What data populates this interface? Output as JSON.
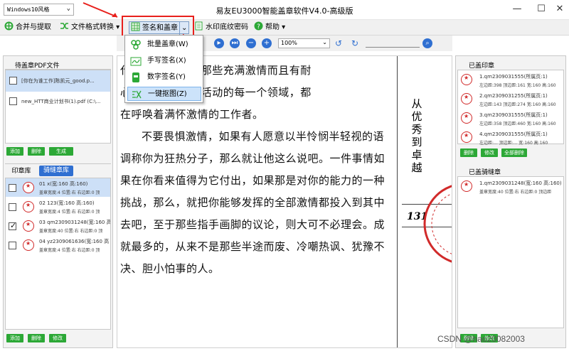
{
  "titlebar": {
    "style_select": "Windows10风格",
    "title": "易友EU3000智能盖章软件V4.0-高级版",
    "min": "—",
    "max": "☐",
    "close": "✕"
  },
  "toolbar": {
    "merge": "合并与提取",
    "convert": "文件格式转换",
    "sign": "签名和盖章",
    "watermark": "水印底纹密码",
    "help": "帮助"
  },
  "menu": {
    "items": [
      {
        "label": "批量盖章",
        "key": "(W)"
      },
      {
        "label": "手写签名",
        "key": "(X)"
      },
      {
        "label": "数字签名",
        "key": "(Y)"
      },
      {
        "label": "一键抠图",
        "key": "(Z)"
      }
    ]
  },
  "left": {
    "pdf_header": "待盖章PDF文件",
    "files": [
      "[你在为谁工作]陈凯元_good.p...",
      "new_HTT商业计划书(1).pdf (C:\\..."
    ],
    "file_buttons": [
      "添加",
      "删除",
      "生成"
    ],
    "tabs": [
      "印章库",
      "骑缝章库"
    ],
    "seals": [
      {
        "name": "01 x(宽:160 高:160)",
        "detail": "盖章宽度:4 位置:右 右边距:0 顶",
        "checked": false
      },
      {
        "name": "02 123(宽:160 高:160)",
        "detail": "盖章宽度:4 位置:右 右边距:0 顶",
        "checked": false
      },
      {
        "name": "03 qm2309031248(宽:160 高",
        "detail": "盖章宽度:40 位置:右 右边距:0 顶",
        "checked": true
      },
      {
        "name": "04 yz2309061636(宽:160 高",
        "detail": "盖章宽度:4 位置:右 右边距:0 顶",
        "checked": false
      }
    ],
    "seal_buttons": [
      "添加",
      "删除",
      "修改"
    ]
  },
  "doctoolbar": {
    "zoom": "100%"
  },
  "document": {
    "lines": [
      "代                物，都等待着那些充满激情而且有耐",
      "心                行各业，人类活动的每一个领域，都",
      "在呼唤着满怀激情的工作者。",
      "不要畏惧激情，如果有人愿意以半怜悯半轻视的语",
      "调称你为狂热分子，那么就让他这么说吧。一件事情如",
      "果在你看来值得为它付出，如果那是对你的能力的一种",
      "挑战，那么，就把你能够发挥的全部激情都投入到其中",
      "去吧，至于那些指手画脚的议论，则大可不必理会。成",
      "就最多的，从来不是那些半途而废、冷嘲热讽、犹豫不",
      "决、胆小怕事的人。"
    ],
    "sidebar_title": "从优秀到卓越",
    "page_number": "131"
  },
  "right": {
    "stamped_header": "已盖印章",
    "stamped": [
      {
        "name": "1.qm2309031555(所属页:1)",
        "detail": "左边距:398 顶边距:161 宽:160 高:160"
      },
      {
        "name": "2.qm2309031255(所属页:1)",
        "detail": "左边距:143 顶边距:274 宽:160 高:160"
      },
      {
        "name": "3.qm2309031555(所属页:1)",
        "detail": "左边距:358 顶边距:460 宽:160 高:160"
      },
      {
        "name": "4.qm2309031555(所属页:1)",
        "detail": "左边距:... 顶边距:... 宽:160 高:160"
      }
    ],
    "stamped_buttons": [
      "删除",
      "修改",
      "全部删除"
    ],
    "seam_header": "已盖骑缝章",
    "seam": [
      {
        "name": "1.qm2309031248(宽:160 高:160)",
        "detail": "盖章宽度:40 位置:右 右边距:0 顶边距"
      }
    ],
    "seam_buttons": [
      "删除",
      "修改"
    ]
  },
  "watermark_text": "CSDN @hao20082003",
  "colors": {
    "accent": "#2f6fd1",
    "green": "#2ca836",
    "red": "#e8201c",
    "seal": "#d12a2a"
  }
}
